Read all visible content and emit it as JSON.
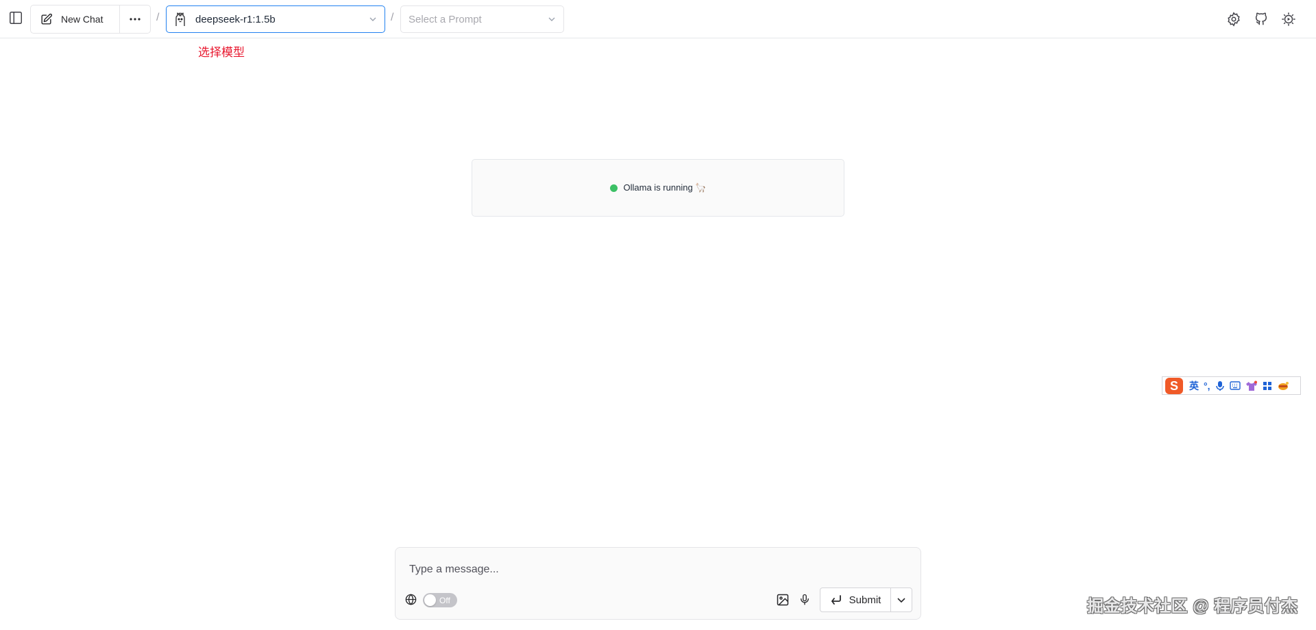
{
  "header": {
    "new_chat_label": "New Chat",
    "separator": "/",
    "model_select": {
      "value": "deepseek-r1:1.5b"
    },
    "prompt_select": {
      "placeholder": "Select a Prompt"
    },
    "right_icons": [
      "settings-icon",
      "github-icon",
      "theme-icon"
    ]
  },
  "annotation": {
    "text": "选择模型",
    "color": "#e8172e"
  },
  "status": {
    "text": "Ollama is running 🦙",
    "dot_color": "#3cc065"
  },
  "ime_toolbar": {
    "logo": "S",
    "mode": "英",
    "punct": "°,",
    "icons": [
      "mic-icon",
      "keyboard-icon",
      "skin-icon",
      "toolbox-icon",
      "mascot-icon"
    ]
  },
  "input": {
    "placeholder": "Type a message...",
    "web_search_toggle": {
      "state": "Off"
    },
    "submit_label": "Submit"
  },
  "watermark": {
    "text": "掘金技术社区 @ 程序员付杰"
  },
  "colors": {
    "accent": "#2080f0",
    "status_green": "#3cc065",
    "annotation_red": "#e8172e"
  }
}
